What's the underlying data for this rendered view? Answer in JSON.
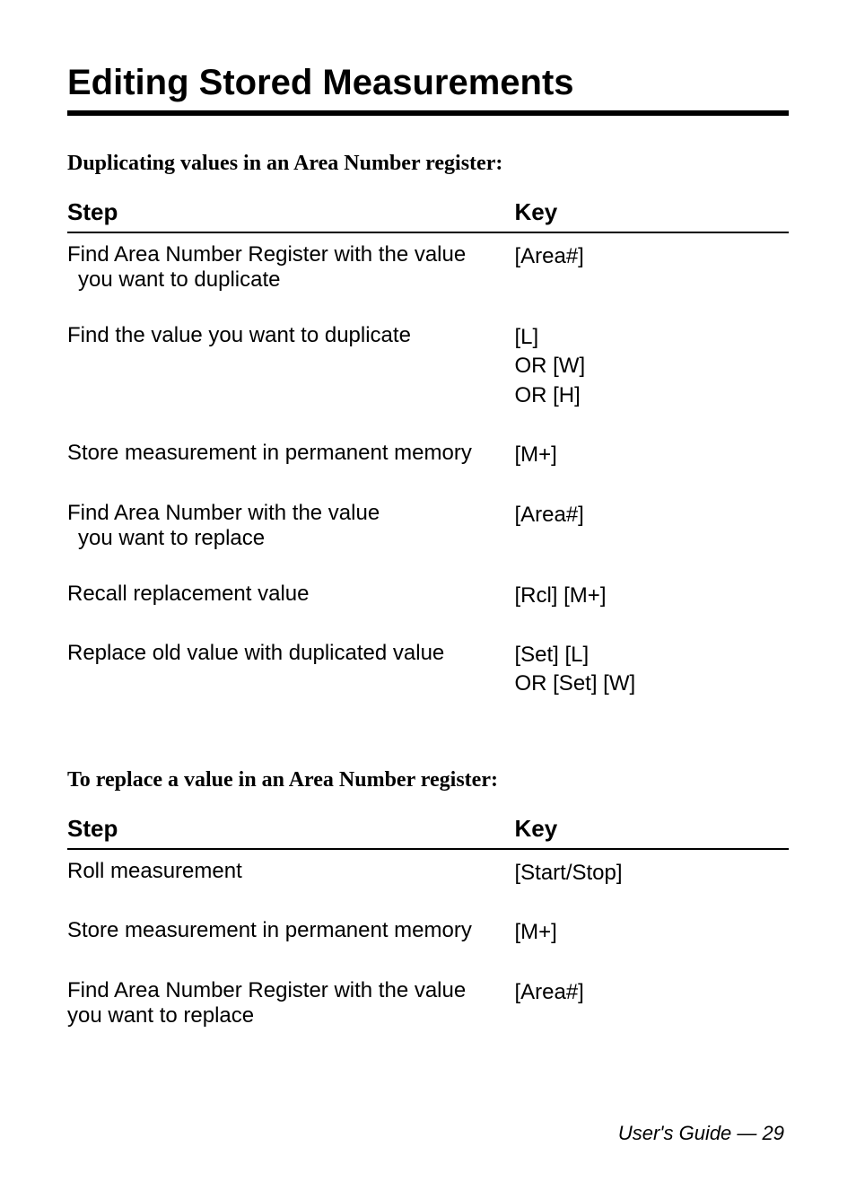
{
  "title": "Editing Stored Measurements",
  "sections": [
    {
      "heading": "Duplicating values in an Area Number register:",
      "header": {
        "step": "Step",
        "key": "Key"
      },
      "rows": [
        {
          "step_line1": "Find Area Number Register with the value",
          "step_line2": "you want to duplicate",
          "step_indent2": true,
          "key_lines": [
            "[Area#]"
          ]
        },
        {
          "step_line1": "Find the value you want to duplicate",
          "key_lines": [
            "[L]",
            "OR  [W]",
            "OR  [H]"
          ]
        },
        {
          "step_line1": "Store measurement in permanent memory",
          "key_lines": [
            "[M+]"
          ]
        },
        {
          "step_line1": "Find Area Number with the value",
          "step_line2": "you want to replace",
          "step_indent2": true,
          "key_lines": [
            "[Area#]"
          ]
        },
        {
          "step_line1": "Recall replacement value",
          "key_lines": [
            "[Rcl] [M+]"
          ]
        },
        {
          "step_line1": "Replace old value with duplicated value",
          "key_lines": [
            "[Set] [L]",
            "OR [Set] [W]"
          ]
        }
      ]
    },
    {
      "heading": "To replace a value in an Area Number register:",
      "header": {
        "step": "Step",
        "key": "Key"
      },
      "rows": [
        {
          "step_line1": "Roll measurement",
          "key_lines": [
            "[Start/Stop]"
          ]
        },
        {
          "step_line1": "Store measurement in permanent memory",
          "key_lines": [
            "[M+]"
          ]
        },
        {
          "step_line1": "Find Area Number Register with the value",
          "step_line2": "you want to replace",
          "step_indent2": false,
          "key_lines": [
            "[Area#]"
          ]
        }
      ]
    }
  ],
  "footer": "User's Guide — 29"
}
